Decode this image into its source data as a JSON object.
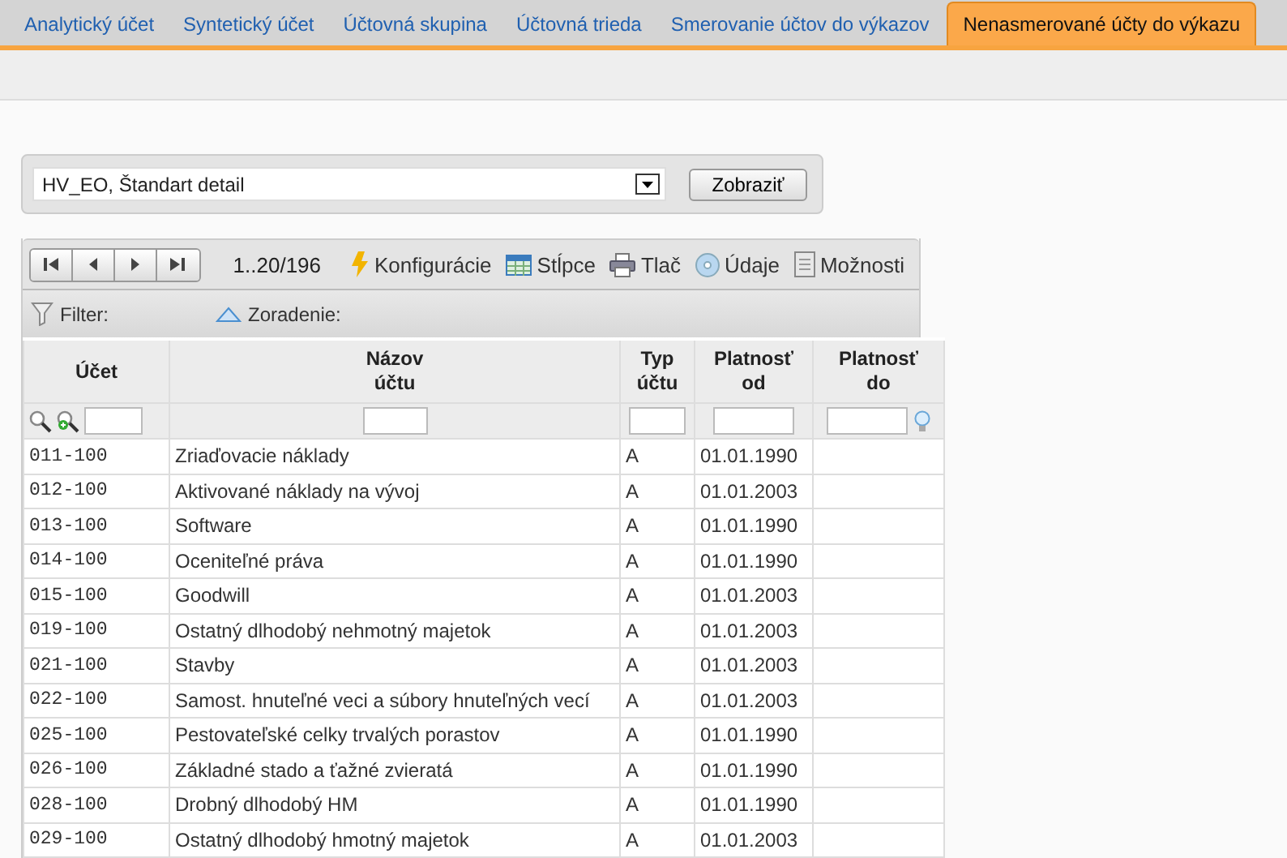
{
  "tabs": [
    {
      "label": "Analytický účet",
      "selected": false
    },
    {
      "label": "Syntetický účet",
      "selected": false
    },
    {
      "label": "Účtovná skupina",
      "selected": false
    },
    {
      "label": "Účtovná trieda",
      "selected": false
    },
    {
      "label": "Smerovanie účtov do výkazov",
      "selected": false
    },
    {
      "label": "Nenasmerované účty do výkazu",
      "selected": true
    }
  ],
  "report_select": {
    "value": "HV_EO, Štandart detail",
    "button": "Zobraziť"
  },
  "toolbar": {
    "range": "1..20/196",
    "actions": [
      {
        "kind": "config",
        "label": "Konfigurácie"
      },
      {
        "kind": "columns",
        "label": "Stĺpce"
      },
      {
        "kind": "print",
        "label": "Tlač"
      },
      {
        "kind": "data",
        "label": "Údaje"
      },
      {
        "kind": "options",
        "label": "Možnosti"
      }
    ]
  },
  "filter_bar": {
    "filter": "Filter:",
    "sort": "Zoradenie:"
  },
  "table": {
    "columns": [
      "Účet",
      "Názov účtu",
      "Typ účtu",
      "Platnosť od",
      "Platnosť do"
    ],
    "rows": [
      [
        "011-100",
        "Zriaďovacie náklady",
        "A",
        "01.01.1990",
        ""
      ],
      [
        "012-100",
        "Aktivované náklady na vývoj",
        "A",
        "01.01.2003",
        ""
      ],
      [
        "013-100",
        "Software",
        "A",
        "01.01.1990",
        ""
      ],
      [
        "014-100",
        "Oceniteľné práva",
        "A",
        "01.01.1990",
        ""
      ],
      [
        "015-100",
        "Goodwill",
        "A",
        "01.01.2003",
        ""
      ],
      [
        "019-100",
        "Ostatný dlhodobý nehmotný majetok",
        "A",
        "01.01.2003",
        ""
      ],
      [
        "021-100",
        "Stavby",
        "A",
        "01.01.2003",
        ""
      ],
      [
        "022-100",
        "Samost. hnuteľné veci a súbory hnuteľných vecí",
        "A",
        "01.01.2003",
        ""
      ],
      [
        "025-100",
        "Pestovateľské celky trvalých porastov",
        "A",
        "01.01.1990",
        ""
      ],
      [
        "026-100",
        "Základné stado a ťažné zvieratá",
        "A",
        "01.01.1990",
        ""
      ],
      [
        "028-100",
        "Drobný dlhodobý HM",
        "A",
        "01.01.1990",
        ""
      ],
      [
        "029-100",
        "Ostatný dlhodobý hmotný majetok",
        "A",
        "01.01.2003",
        ""
      ]
    ]
  }
}
